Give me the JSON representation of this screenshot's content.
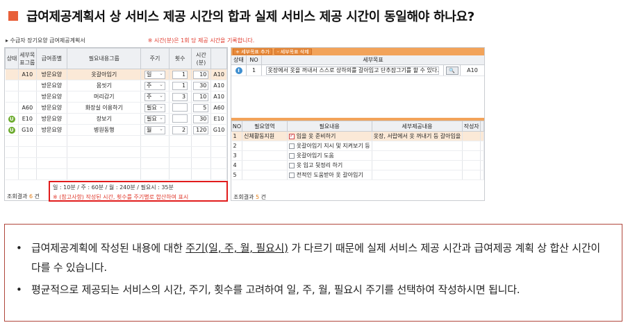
{
  "title": "급여제공계획서 상 서비스 제공 시간의 합과 실제 서비스 제공 시간이 동일해야 하나요?",
  "colors": {
    "accent": "#e8603a",
    "warning": "#e0382b",
    "orange": "#f2a35a",
    "selected_row": "#fbe9d7"
  },
  "screen": {
    "breadcrumb": "▸ 수급자 장기요양 급여제공계획서",
    "warning_text": "※ 시간(분)은 1회 당 제공 시간을 기록합니다.",
    "left_table": {
      "headers": [
        "상태",
        "세부목표그룹",
        "급여종별",
        "필요내용그룹",
        "주기",
        "횟수",
        "시간(분)",
        ""
      ],
      "rows": [
        {
          "status": "",
          "group": "A10",
          "type": "방문요양",
          "need": "옷갈아입기",
          "cycle": "일",
          "count": "1",
          "time": "10",
          "extra": "A10",
          "selected": true
        },
        {
          "status": "",
          "group": "",
          "type": "방문요양",
          "need": "몸씻기",
          "cycle": "주",
          "count": "1",
          "time": "30",
          "extra": "A10",
          "selected": false
        },
        {
          "status": "",
          "group": "",
          "type": "방문요양",
          "need": "머리감기",
          "cycle": "주",
          "count": "3",
          "time": "10",
          "extra": "A10",
          "selected": false
        },
        {
          "status": "",
          "group": "A60",
          "type": "방문요양",
          "need": "화장실 이용하기",
          "cycle": "필요",
          "count": "",
          "time": "5",
          "extra": "A60",
          "selected": false
        },
        {
          "status": "U",
          "group": "E10",
          "type": "방문요양",
          "need": "장보기",
          "cycle": "필요",
          "count": "",
          "time": "30",
          "extra": "E10",
          "selected": false
        },
        {
          "status": "U",
          "group": "G10",
          "type": "방문요양",
          "need": "병원동행",
          "cycle": "월",
          "count": "2",
          "time": "120",
          "extra": "G10",
          "selected": false
        }
      ]
    },
    "summary": {
      "line1": "일 : 10분 / 주 : 60분 / 월 : 240분 / 필요시 : 35분",
      "line2": "※ (참고사항) 작성된 시간, 횟수를 주기별로 합산하여 표시"
    },
    "left_count_label": "조회결과",
    "left_count": "6",
    "count_unit": "건",
    "right": {
      "btn_add": "+ 세부목표 추가",
      "btn_delete": "- 세부목표 삭제",
      "goal_headers": [
        "상태",
        "NO",
        "세부목표"
      ],
      "goal_row": {
        "status": "I",
        "no": "1",
        "goal": "옷장에서 옷을 꺼내서 스스로 상하의를 갈아입고 단추잠그기를 할 수 있다.",
        "code": "A10"
      },
      "sub_headers": [
        "NO",
        "필요영역",
        "필요내용",
        "세부제공내용",
        "작성자"
      ],
      "sub_rows": [
        {
          "no": "1",
          "area": "신체활동지원",
          "need": "입을 옷 준비하기",
          "detail": "옷장, 서랍에서 옷 꺼내기 등 갈아입을",
          "writer": "",
          "checked": true
        },
        {
          "no": "2",
          "area": "",
          "need": "옷갈아입기 지시 및 지켜보기 등",
          "detail": "",
          "writer": "",
          "checked": false
        },
        {
          "no": "3",
          "area": "",
          "need": "옷갈아입기 도움",
          "detail": "",
          "writer": "",
          "checked": false
        },
        {
          "no": "4",
          "area": "",
          "need": "옷 입고 뒷정리 하기",
          "detail": "",
          "writer": "",
          "checked": false
        },
        {
          "no": "5",
          "area": "",
          "need": "전적인 도움받아 옷 갈아입기",
          "detail": "",
          "writer": "",
          "checked": false
        }
      ],
      "count_label": "조회결과",
      "count": "5"
    }
  },
  "notes": {
    "bullet": "•",
    "item1_pre": "급여제공계획에 작성된 내용에 대한 ",
    "item1_underline": "주기(일, 주, 월, 필요시)",
    "item1_post": " 가 다르기 때문에 실제 서비스 제공 시간과  급여제공 계획 상 합산 시간이 다를 수 있습니다.",
    "item2": "평균적으로 제공되는 서비스의 시간, 주기, 횟수를 고려하여 일, 주, 월, 필요시 주기를 선택하여 작성하시면 됩니다."
  }
}
